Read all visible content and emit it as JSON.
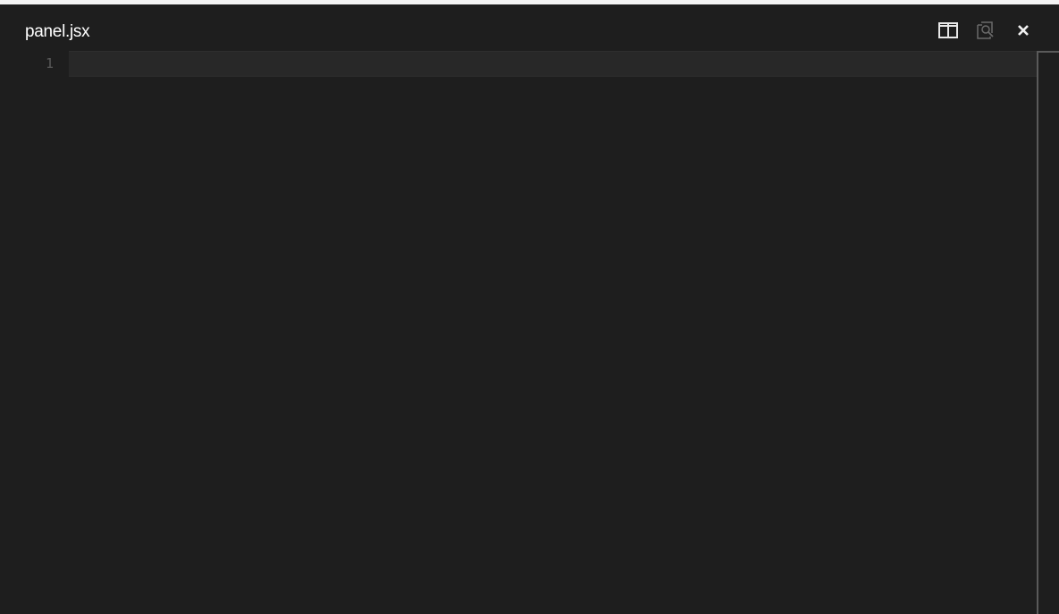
{
  "editor": {
    "file_name": "panel.jsx",
    "lines": [
      {
        "number": "1",
        "text": ""
      }
    ]
  },
  "toolbar": {
    "icons": [
      "split-editor-icon",
      "open-preview-icon",
      "close-icon"
    ]
  },
  "colors": {
    "background": "#1e1e1e",
    "current_line": "#282828",
    "line_number": "#5a5a5a",
    "title_text": "#ffffff",
    "icon_active": "#e8e8e8",
    "icon_disabled": "#6a6a6a"
  }
}
